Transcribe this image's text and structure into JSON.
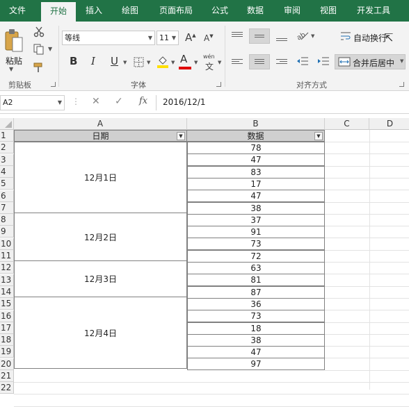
{
  "tabs": [
    {
      "label": "文件"
    },
    {
      "label": "开始"
    },
    {
      "label": "插入"
    },
    {
      "label": "绘图"
    },
    {
      "label": "页面布局"
    },
    {
      "label": "公式"
    },
    {
      "label": "数据"
    },
    {
      "label": "审阅"
    },
    {
      "label": "视图"
    },
    {
      "label": "开发工具"
    }
  ],
  "ribbon": {
    "clipboard": {
      "paste_label": "粘贴",
      "group_label": "剪贴板"
    },
    "font": {
      "font_name": "等线",
      "font_size": "11",
      "group_label": "字体",
      "bold": "B",
      "italic": "I",
      "underline": "U",
      "increase": "A",
      "decrease": "A",
      "font_color_letter": "A",
      "phonetic_top": "wén",
      "phonetic_bottom": "文",
      "font_color": "#e00000"
    },
    "alignment": {
      "wrap_text_label": "自动换行",
      "merge_center_label": "合并后居中",
      "group_label": "对齐方式"
    }
  },
  "formula_bar": {
    "name_box": "A2",
    "fx": "fx",
    "content": "2016/12/1"
  },
  "sheet": {
    "columns": [
      "A",
      "B",
      "C",
      "D"
    ],
    "rows": [
      "1",
      "2",
      "3",
      "4",
      "5",
      "6",
      "7",
      "8",
      "9",
      "10",
      "11",
      "12",
      "13",
      "14",
      "15",
      "16",
      "17",
      "18",
      "19",
      "20",
      "21",
      "22"
    ],
    "header": {
      "col_a": "日期",
      "col_b": "数据"
    },
    "dates": [
      "12月1日",
      "12月2日",
      "12月3日",
      "12月4日"
    ],
    "values": [
      "78",
      "47",
      "83",
      "17",
      "47",
      "38",
      "37",
      "91",
      "73",
      "72",
      "63",
      "81",
      "87",
      "36",
      "73",
      "18",
      "38",
      "47",
      "97"
    ]
  }
}
